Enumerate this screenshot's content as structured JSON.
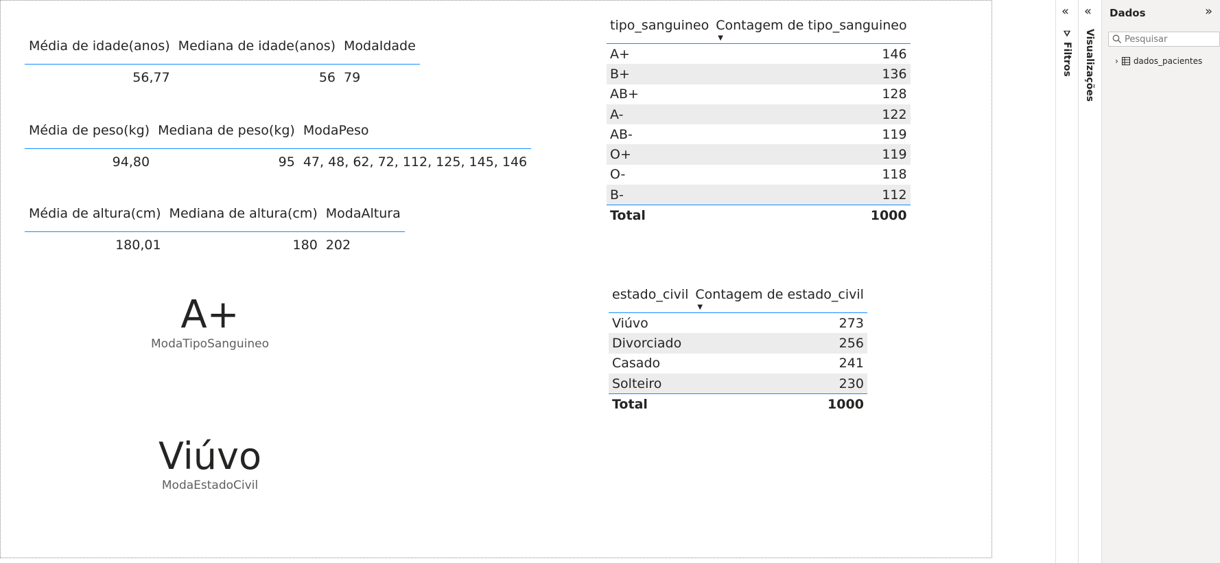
{
  "measures": {
    "idade": {
      "headers": [
        "Média de idade(anos)",
        "Mediana de idade(anos)",
        "ModaIdade"
      ],
      "values": [
        "56,77",
        "56",
        "79"
      ]
    },
    "peso": {
      "headers": [
        "Média de peso(kg)",
        "Mediana de peso(kg)",
        "ModaPeso"
      ],
      "values": [
        "94,80",
        "95",
        "47, 48, 62, 72, 112, 125, 145, 146"
      ]
    },
    "altura": {
      "headers": [
        "Média de altura(cm)",
        "Mediana de altura(cm)",
        "ModaAltura"
      ],
      "values": [
        "180,01",
        "180",
        "202"
      ]
    }
  },
  "cards": {
    "tipo": {
      "value": "A+",
      "label": "ModaTipoSanguineo"
    },
    "estado": {
      "value": "Viúvo",
      "label": "ModaEstadoCivil"
    }
  },
  "blood_table": {
    "headers": [
      "tipo_sanguineo",
      "Contagem de tipo_sanguineo"
    ],
    "rows": [
      {
        "label": "A+",
        "value": "146"
      },
      {
        "label": "B+",
        "value": "136"
      },
      {
        "label": "AB+",
        "value": "128"
      },
      {
        "label": "A-",
        "value": "122"
      },
      {
        "label": "AB-",
        "value": "119"
      },
      {
        "label": "O+",
        "value": "119"
      },
      {
        "label": "O-",
        "value": "118"
      },
      {
        "label": "B-",
        "value": "112"
      }
    ],
    "total_label": "Total",
    "total_value": "1000"
  },
  "civil_table": {
    "headers": [
      "estado_civil",
      "Contagem de estado_civil"
    ],
    "rows": [
      {
        "label": "Viúvo",
        "value": "273"
      },
      {
        "label": "Divorciado",
        "value": "256"
      },
      {
        "label": "Casado",
        "value": "241"
      },
      {
        "label": "Solteiro",
        "value": "230"
      }
    ],
    "total_label": "Total",
    "total_value": "1000"
  },
  "panes": {
    "filters_label": "Filtros",
    "viz_label": "Visualizações",
    "data_title": "Dados",
    "search_placeholder": "Pesquisar",
    "tree_item": "dados_pacientes"
  },
  "colors": {
    "accent": "#118dff",
    "alt_row": "#ececec",
    "pane_bg": "#f3f2f1"
  }
}
